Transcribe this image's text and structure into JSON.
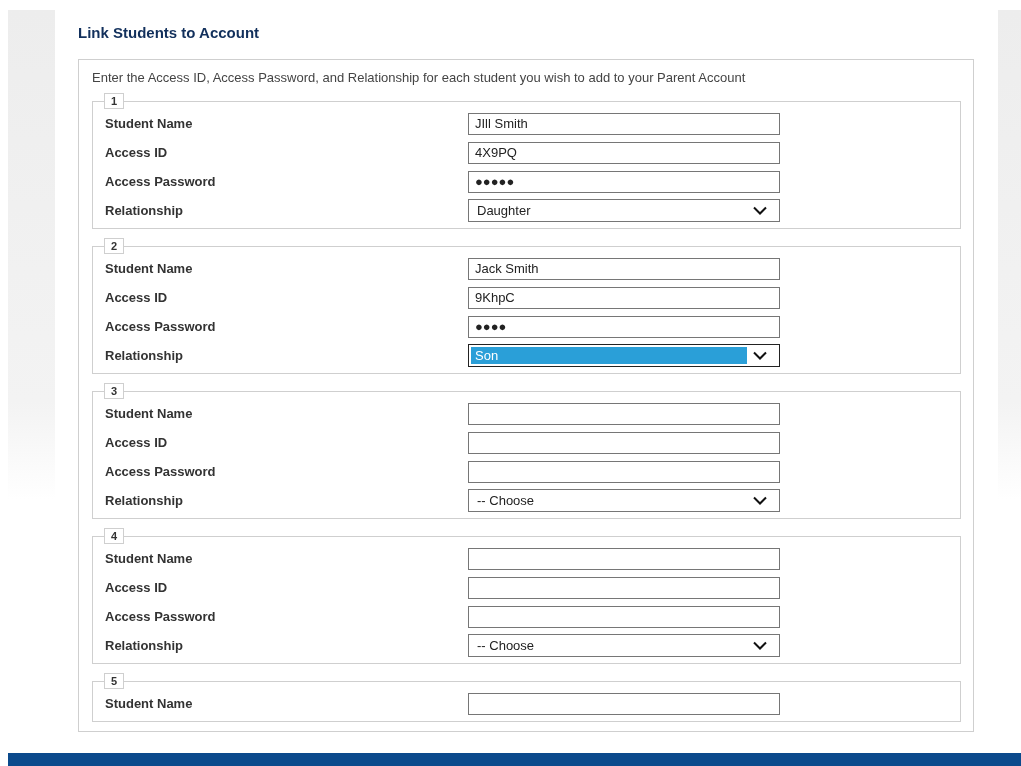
{
  "title": "Link Students to Account",
  "instructions": "Enter the Access ID, Access Password, and Relationship for each student you wish to add to your Parent Account",
  "students": [
    {
      "number": "1",
      "rows": [
        {
          "kind": "text",
          "label": "Student Name",
          "value": "JIll Smith"
        },
        {
          "kind": "text",
          "label": "Access ID",
          "value": "4X9PQ"
        },
        {
          "kind": "password",
          "label": "Access Password",
          "value": "●●●●●"
        },
        {
          "kind": "select",
          "label": "Relationship",
          "value": "Daughter",
          "highlighted": false
        }
      ]
    },
    {
      "number": "2",
      "rows": [
        {
          "kind": "text",
          "label": "Student Name",
          "value": "Jack Smith"
        },
        {
          "kind": "text",
          "label": "Access ID",
          "value": "9KhpC"
        },
        {
          "kind": "password",
          "label": "Access Password",
          "value": "●●●●"
        },
        {
          "kind": "select",
          "label": "Relationship",
          "value": "Son",
          "highlighted": true
        }
      ]
    },
    {
      "number": "3",
      "rows": [
        {
          "kind": "text",
          "label": "Student Name"
        },
        {
          "kind": "text",
          "label": "Access ID"
        },
        {
          "kind": "password",
          "label": "Access Password"
        },
        {
          "kind": "select",
          "label": "Relationship",
          "value": "-- Choose",
          "highlighted": false
        }
      ]
    },
    {
      "number": "4",
      "rows": [
        {
          "kind": "text",
          "label": "Student Name"
        },
        {
          "kind": "text",
          "label": "Access ID"
        },
        {
          "kind": "password",
          "label": "Access Password"
        },
        {
          "kind": "select",
          "label": "Relationship",
          "value": "-- Choose",
          "highlighted": false
        }
      ]
    },
    {
      "number": "5",
      "rows": [
        {
          "kind": "text",
          "label": "Student Name"
        }
      ]
    }
  ]
}
